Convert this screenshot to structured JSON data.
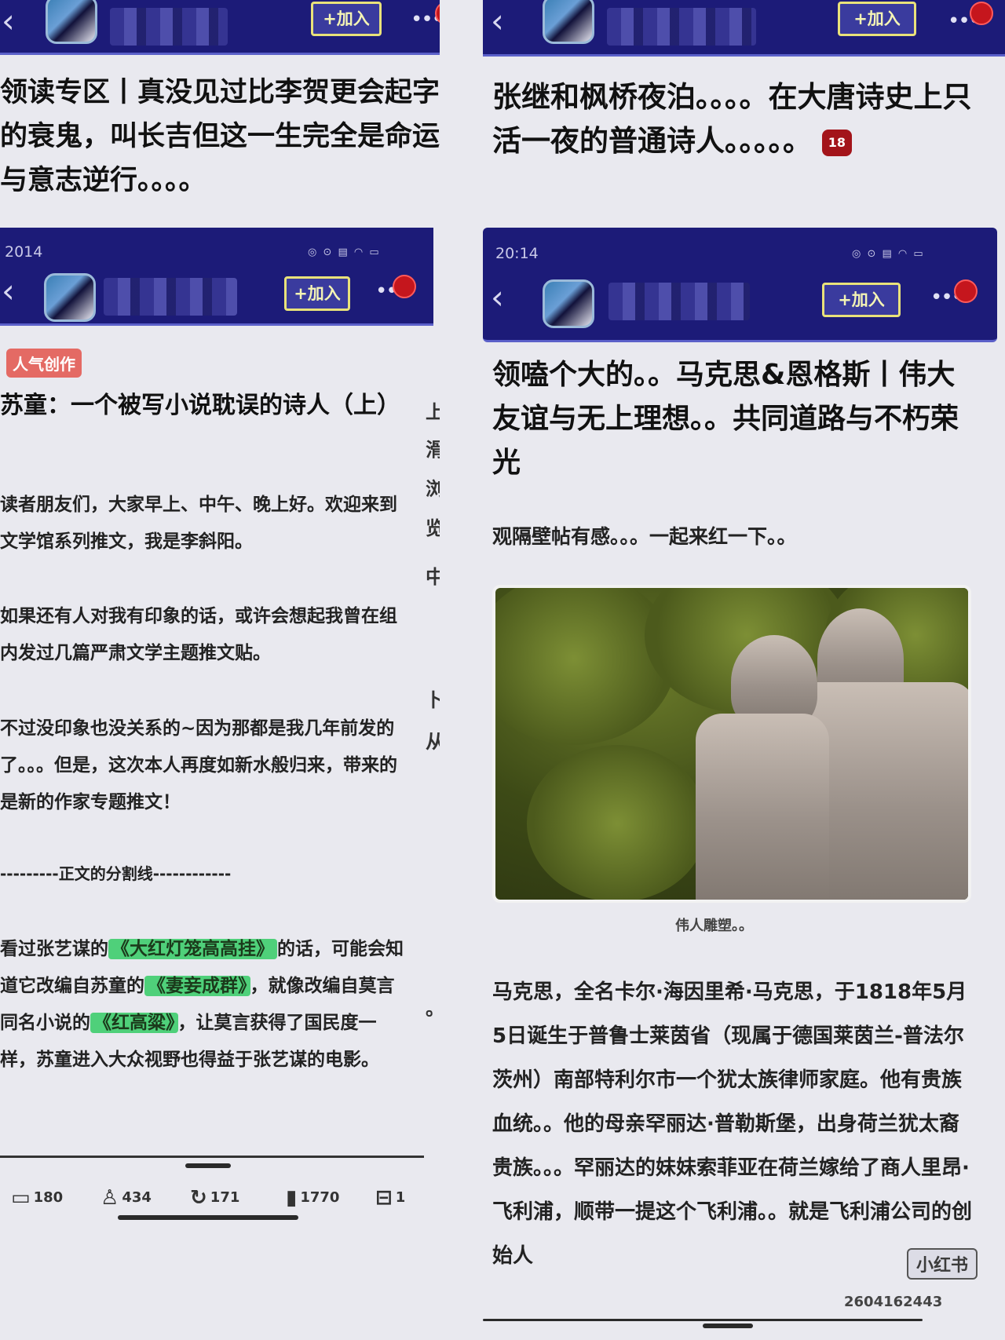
{
  "colors": {
    "header": "#1c1b78",
    "join_border": "#e9e27a",
    "notif": "#c5161d",
    "tag": "#4fd07a",
    "badge": "#e46a64"
  },
  "left": {
    "top_bar": {
      "back_icon": "chevron-left-icon",
      "join_label": "+加入",
      "more_label": "•••"
    },
    "prev_title": "领读专区丨真没见过比李贺更会起字的衰鬼，叫长吉但这一生完全是命运与意志逆行。。。。",
    "bar": {
      "time": "2014",
      "join_label": "+加入",
      "more_label": "•••"
    },
    "badge": "人气创作",
    "title": "苏童：一个被写小说耽误的诗人（上）",
    "paragraphs": [
      "读者朋友们，大家早上、中午、晚上好。欢迎来到文学馆系列推文，我是李斜阳。",
      "如果还有人对我有印象的话，或许会想起我曾在组内发过几篇严肃文学主题推文贴。",
      "不过没印象也没关系的~因为那都是我几年前发的了。。。但是，这次本人再度如新水般归来，带来的是新的作家专题推文！",
      "---------正文的分割线------------"
    ],
    "final_paragraph": {
      "p1": "看过张艺谋的",
      "tag1": "《大红灯笼高高挂》",
      "p2": "的话，可能会知道它改编自苏童的",
      "tag2": "《妻妾成群》",
      "p3": "，就像改编自莫言同名小说的",
      "tag3": "《红高粱》",
      "p4": "，让莫言获得了国民度一样，苏童进入大众视野也得益于张艺谋的电影。"
    },
    "side_chars": [
      "上",
      "滑",
      "浏",
      "览",
      "中",
      "卜",
      "从",
      "。"
    ],
    "stats": [
      {
        "icon": "comment-icon",
        "value": "180"
      },
      {
        "icon": "like-icon",
        "value": "434"
      },
      {
        "icon": "share-icon",
        "value": "171"
      },
      {
        "icon": "bookmark-icon",
        "value": "1770"
      },
      {
        "icon": "gift-icon",
        "value": "1"
      }
    ]
  },
  "right": {
    "top_bar": {
      "back_icon": "chevron-left-icon",
      "join_label": "+加入",
      "more_label": "•••"
    },
    "prev_title": "张继和枫桥夜泊。。。。在大唐诗史上只活一夜的普通诗人。。。。。",
    "prev_count": "18",
    "bar": {
      "time": "20:14",
      "join_label": "+加入",
      "more_label": "•••"
    },
    "title": "领嗑个大的。。马克思&恩格斯丨伟大友谊与无上理想。。共同道路与不朽荣光",
    "intro": "观隔壁帖有感。。。一起来红一下。。",
    "photo_alt": "statue-photo",
    "caption": "伟人雕塑。。",
    "paragraph": "马克思，全名卡尔·海因里希·马克思，于1818年5月5日诞生于普鲁士莱茵省（现属于德国莱茵兰-普法尔茨州）南部特利尔市一个犹太族律师家庭。他有贵族血统。。他的母亲罕丽达·普勒斯堡，出身荷兰犹太裔贵族。。。罕丽达的妹妹索菲亚在荷兰嫁给了商人里昂·飞利浦，顺带一提这个飞利浦。。就是飞利浦公司的创始人",
    "watermark": "小红书",
    "watermark_id": "2604162443"
  }
}
